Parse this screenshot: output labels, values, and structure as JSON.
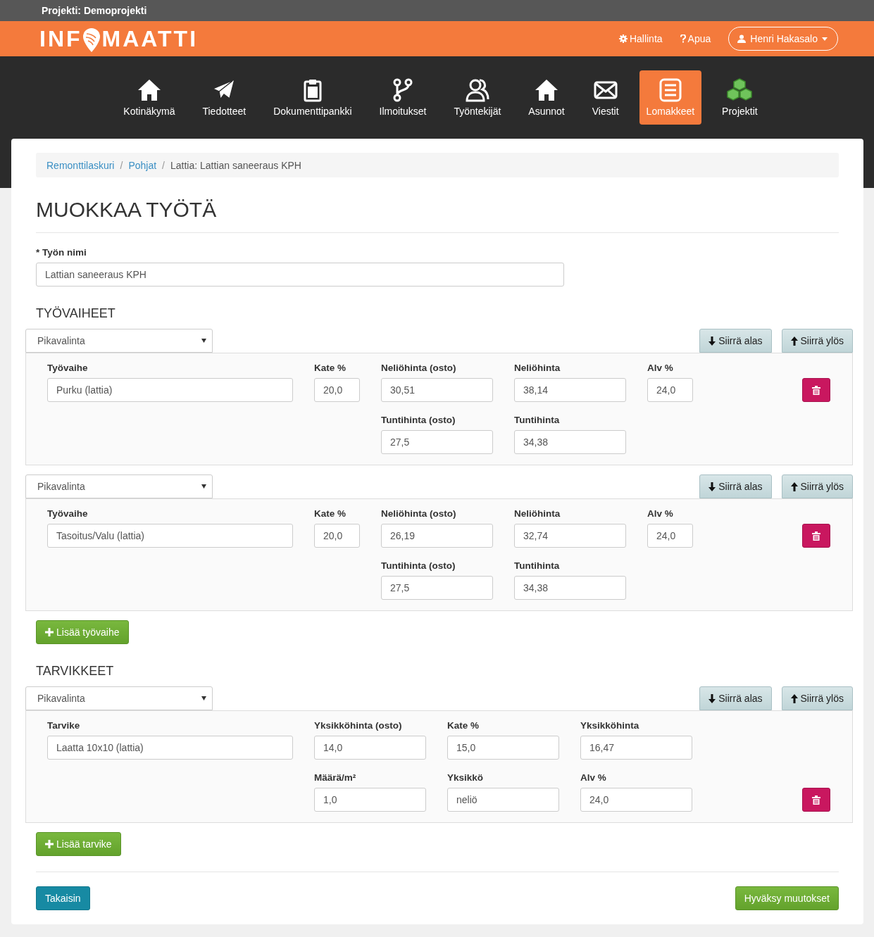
{
  "project_bar": {
    "title": "Projekti: Demoprojekti"
  },
  "header": {
    "logo_start": "INF",
    "logo_end": "MAATTI",
    "links": [
      {
        "kind": "gear",
        "label": "Hallinta"
      },
      {
        "kind": "question",
        "label": "Apua"
      }
    ],
    "user": {
      "name": "Henri Hakasalo"
    }
  },
  "nav": [
    {
      "kind": "home",
      "label": "Kotinäkymä",
      "selected": false
    },
    {
      "kind": "plane",
      "label": "Tiedotteet",
      "selected": false
    },
    {
      "kind": "clipboard",
      "label": "Dokumenttipankki",
      "selected": false
    },
    {
      "kind": "branch",
      "label": "Ilmoitukset",
      "selected": false
    },
    {
      "kind": "users",
      "label": "Työntekijät",
      "selected": false
    },
    {
      "kind": "home",
      "label": "Asunnot",
      "selected": false
    },
    {
      "kind": "envelope",
      "label": "Viestit",
      "selected": false
    },
    {
      "kind": "list",
      "label": "Lomakkeet",
      "selected": true
    },
    {
      "kind": "cubes",
      "label": "Projektit",
      "selected": false
    }
  ],
  "breadcrumb": {
    "separator": "/",
    "items": [
      {
        "label": "Remonttilaskuri",
        "current": false
      },
      {
        "label": "Pohjat",
        "current": false
      },
      {
        "label": "Lattia: Lattian saneeraus KPH",
        "current": true
      }
    ]
  },
  "page_title": "MUOKKAA TYÖTÄ",
  "job_name": {
    "label": "* Työn nimi",
    "value": "Lattian saneeraus KPH"
  },
  "sections": [
    {
      "kind": "stages",
      "title": "TYÖVAIHEET",
      "add_button": "Lisää työvaihe",
      "items": [
        {
          "select": "Pikavalinta",
          "move_down": "Siirrä alas",
          "move_up": "Siirrä ylös",
          "fields": [
            {
              "label": "Työvaihe",
              "value": "Purku (lattia)"
            },
            {
              "label": "Kate %",
              "value": "20,0"
            },
            {
              "label": "Neliöhinta (osto)",
              "value": "30,51"
            },
            {
              "label": "Neliöhinta",
              "value": "38,14"
            },
            {
              "label": "Alv %",
              "value": "24,0"
            },
            {
              "label": "Tuntihinta (osto)",
              "value": "27,5"
            },
            {
              "label": "Tuntihinta",
              "value": "34,38"
            }
          ]
        },
        {
          "select": "Pikavalinta",
          "move_down": "Siirrä alas",
          "move_up": "Siirrä ylös",
          "fields": [
            {
              "label": "Työvaihe",
              "value": "Tasoitus/Valu (lattia)"
            },
            {
              "label": "Kate %",
              "value": "20,0"
            },
            {
              "label": "Neliöhinta (osto)",
              "value": "26,19"
            },
            {
              "label": "Neliöhinta",
              "value": "32,74"
            },
            {
              "label": "Alv %",
              "value": "24,0"
            },
            {
              "label": "Tuntihinta (osto)",
              "value": "27,5"
            },
            {
              "label": "Tuntihinta",
              "value": "34,38"
            }
          ]
        }
      ]
    },
    {
      "kind": "materials",
      "title": "TARVIKKEET",
      "add_button": "Lisää tarvike",
      "items": [
        {
          "select": "Pikavalinta",
          "move_down": "Siirrä alas",
          "move_up": "Siirrä ylös",
          "fields": [
            {
              "label": "Tarvike",
              "value": "Laatta 10x10 (lattia)"
            },
            {
              "label": "Yksikköhinta (osto)",
              "value": "14,0"
            },
            {
              "label": "Kate %",
              "value": "15,0"
            },
            {
              "label": "Yksikköhinta",
              "value": "16,47"
            },
            {
              "label": "Määrä/m²",
              "value": "1,0"
            },
            {
              "label": "Yksikkö",
              "value": "neliö"
            },
            {
              "label": "Alv %",
              "value": "24,0"
            }
          ]
        }
      ]
    }
  ],
  "footer": {
    "back_button": "Takaisin",
    "save_button": "Hyväksy muutokset"
  }
}
